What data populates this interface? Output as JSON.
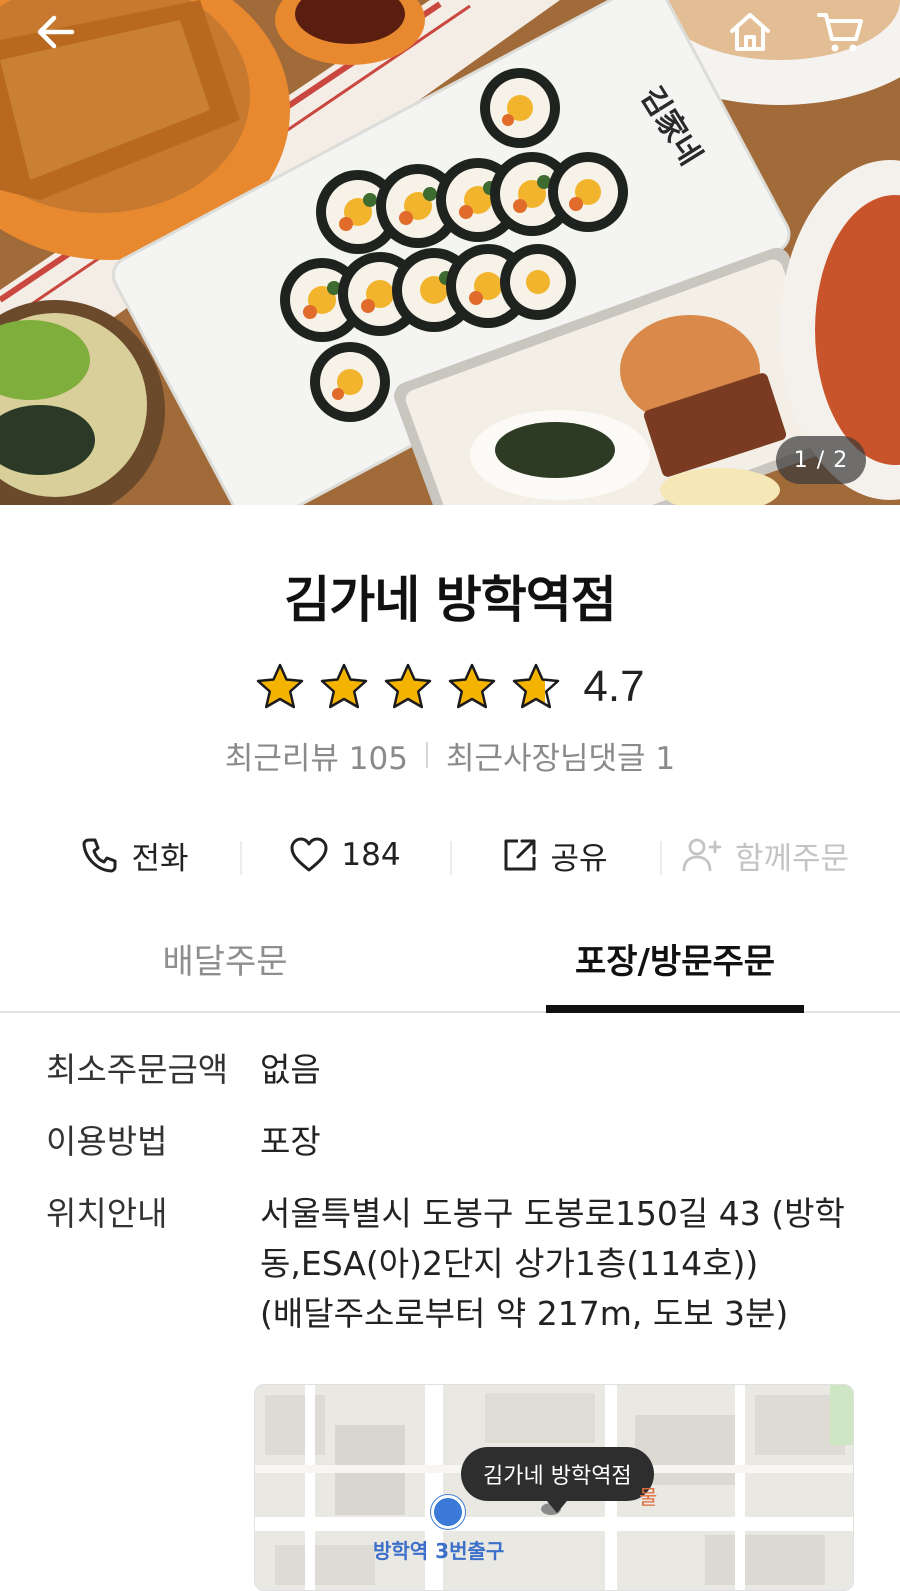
{
  "hero": {
    "page_indicator": "1 / 2",
    "logo_text": "김家네",
    "back_icon": "arrow-left-icon",
    "home_icon": "home-icon",
    "cart_icon": "cart-icon"
  },
  "store": {
    "name": "김가네 방학역점",
    "rating": "4.7",
    "rating_value": 4.7,
    "recent_reviews": "최근리뷰 105",
    "owner_comments": "최근사장님댓글 1"
  },
  "actions": {
    "call": {
      "label": "전화",
      "icon": "phone-icon"
    },
    "like": {
      "label": "184",
      "icon": "heart-icon"
    },
    "share": {
      "label": "공유",
      "icon": "share-icon"
    },
    "group": {
      "label": "함께주문",
      "icon": "add-user-icon"
    }
  },
  "tabs": [
    {
      "label": "배달주문",
      "active": false
    },
    {
      "label": "포장/방문주문",
      "active": true
    }
  ],
  "info": {
    "min_order": {
      "label": "최소주문금액",
      "value": "없음"
    },
    "method": {
      "label": "이용방법",
      "value": "포장"
    },
    "location": {
      "label": "위치안내",
      "line1": "서울특별시 도봉구 도봉로150길 43 (방학",
      "line2": "동,ESA(아)2단지 상가1층(114호))",
      "line3": "(배달주소로부터 약 217m, 도보 3분)"
    }
  },
  "map": {
    "marker_label": "김가네 방학역점",
    "station_label": "방학역 3번출구",
    "partial_label": "물"
  },
  "colors": {
    "star": "#f5b301",
    "active_tab": "#111111",
    "station": "#3b7ad9"
  }
}
